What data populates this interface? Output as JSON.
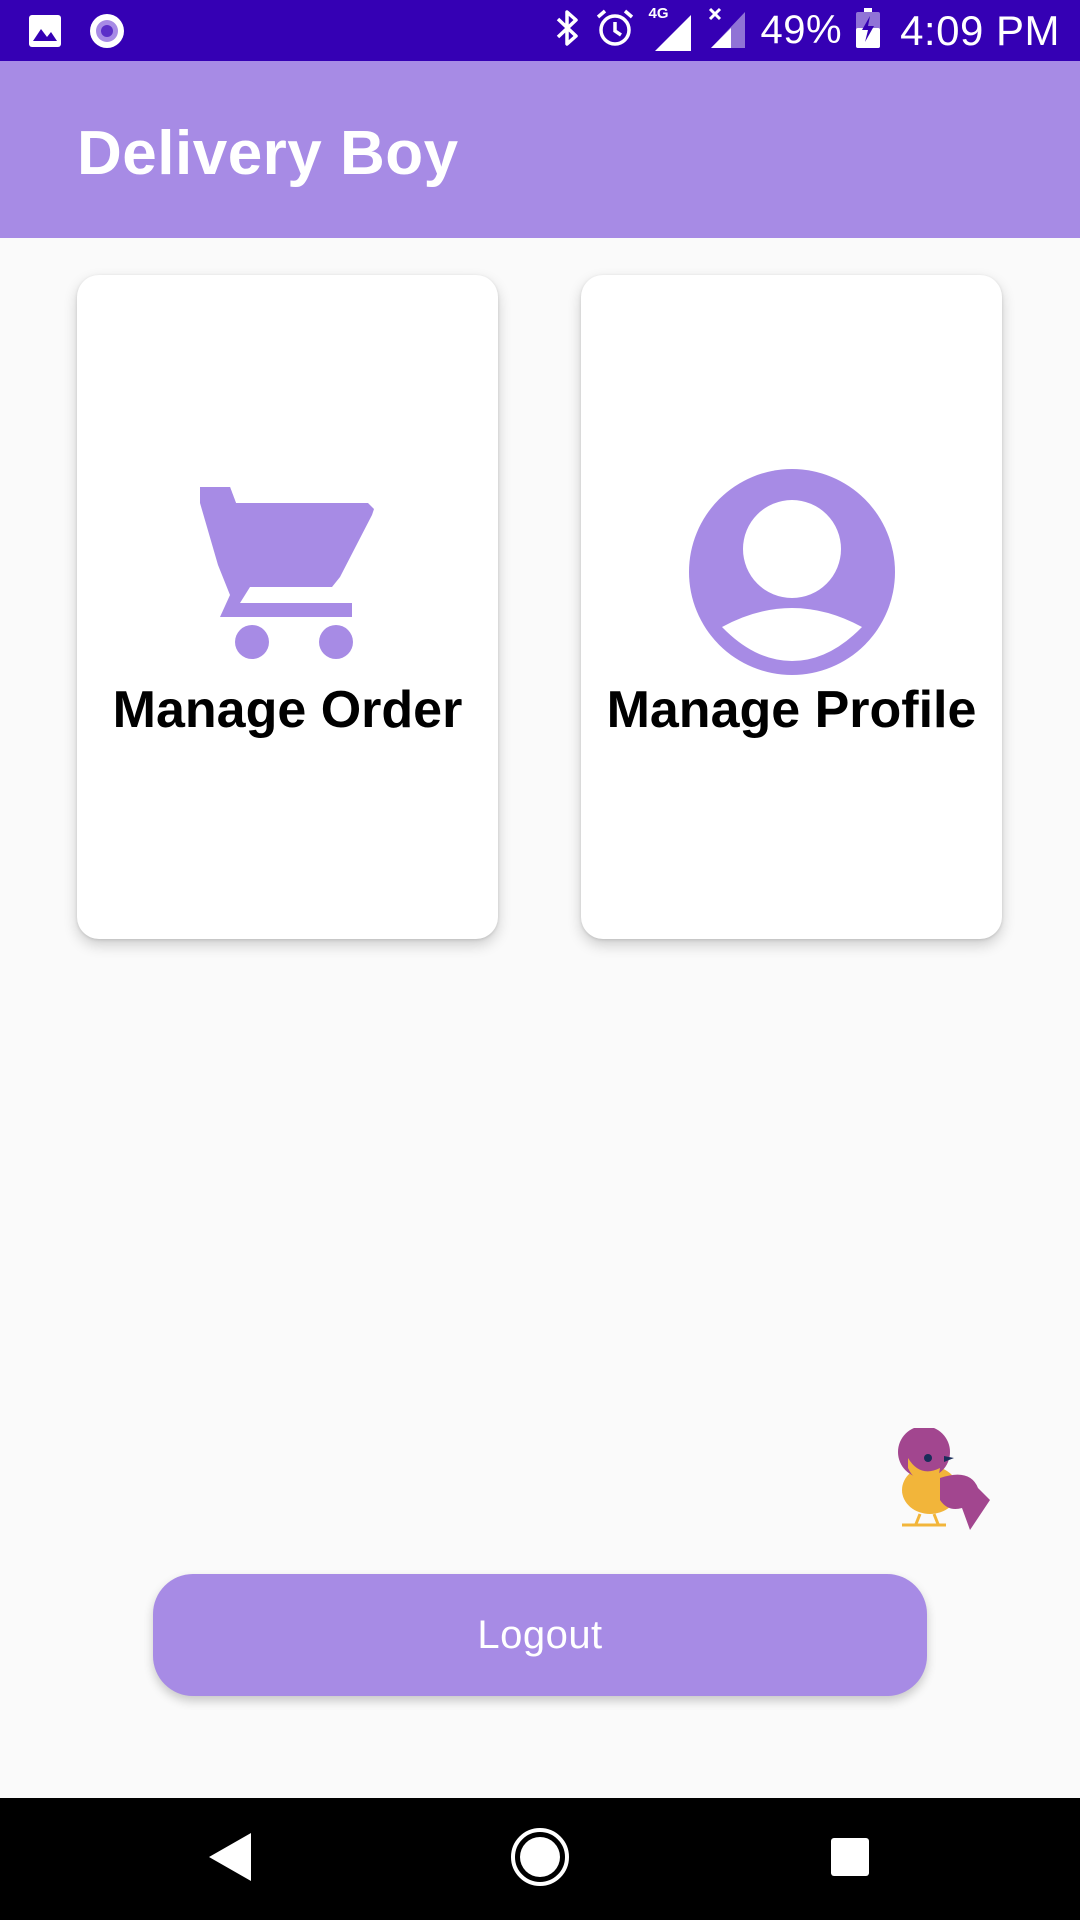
{
  "status_bar": {
    "battery": "49%",
    "time": "4:09 PM",
    "network": "4G",
    "icons": [
      "image-icon",
      "record-icon",
      "bluetooth-icon",
      "alarm-icon",
      "signal-icon",
      "signal-no-data-icon",
      "battery-charging-icon"
    ]
  },
  "app_bar": {
    "title": "Delivery Boy"
  },
  "cards": [
    {
      "label": "Manage Order",
      "icon": "cart-icon"
    },
    {
      "label": "Manage Profile",
      "icon": "account-circle-icon"
    }
  ],
  "logout": {
    "label": "Logout"
  },
  "nav_bar": {
    "icons": [
      "back-icon",
      "home-icon",
      "recents-icon"
    ]
  },
  "colors": {
    "status_bar": "#3500b4",
    "primary": "#a78be5",
    "background": "#fafafa",
    "card": "#ffffff",
    "text": "#000000"
  }
}
